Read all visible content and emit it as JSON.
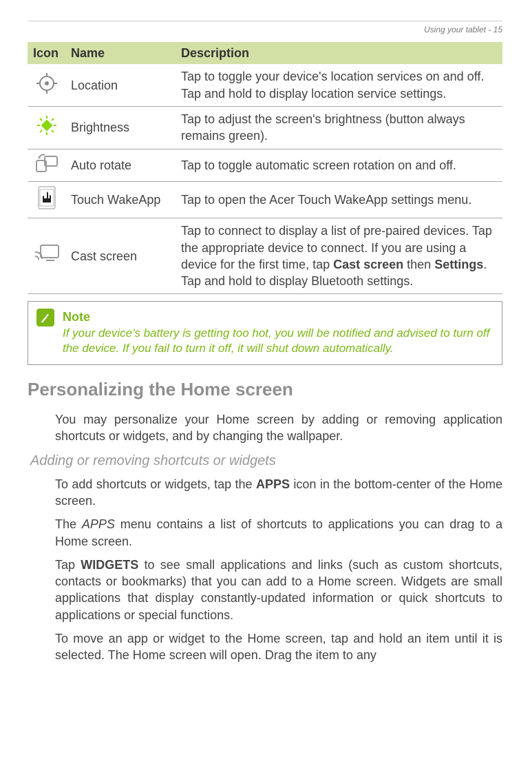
{
  "page_header": "Using your tablet - 15",
  "table": {
    "headers": {
      "icon": "Icon",
      "name": "Name",
      "desc": "Description"
    },
    "rows": [
      {
        "icon": "location-icon",
        "name": "Location",
        "desc": "Tap to toggle your device's location services on and off. Tap and hold to display location service settings."
      },
      {
        "icon": "brightness-icon",
        "name": "Brightness",
        "desc": "Tap to adjust the screen's brightness (button always remains green)."
      },
      {
        "icon": "auto-rotate-icon",
        "name": "Auto rotate",
        "desc": "Tap to toggle automatic screen rotation on and off."
      },
      {
        "icon": "touch-wakeapp-icon",
        "name": "Touch WakeApp",
        "desc": "Tap to open the Acer Touch WakeApp settings menu."
      },
      {
        "icon": "cast-screen-icon",
        "name": "Cast screen",
        "desc_pre": "Tap to connect to display a list of pre-paired devices. Tap the appropriate device to connect. If you are using a device for the first time, tap ",
        "desc_bold1": "Cast screen",
        "desc_mid": " then ",
        "desc_bold2": "Settings",
        "desc_post": ". Tap and hold to display Bluetooth settings."
      }
    ]
  },
  "note": {
    "label": "Note",
    "text": "If your device's battery is getting too hot, you will be notified and advised to turn off the device. If you fail to turn it off, it will shut down automatically."
  },
  "section_heading": "Personalizing the Home screen",
  "para1": "You may personalize your Home screen by adding or removing application shortcuts or widgets, and by changing the wallpaper.",
  "sub_heading": "Adding or removing shortcuts or widgets",
  "para2_pre": "To add shortcuts or widgets, tap the ",
  "para2_bold": "APPS",
  "para2_post": " icon in the bottom-center of the Home screen.",
  "para3_pre": "The ",
  "para3_italic": "APPS",
  "para3_post": " menu contains a list of shortcuts to applications you can drag to a Home screen.",
  "para4_pre": "Tap ",
  "para4_bold": "WIDGETS",
  "para4_post": " to see small applications and links (such as custom shortcuts, contacts or bookmarks) that you can add to a Home screen. Widgets are small applications that display constantly-updated information or quick shortcuts to applications or special functions.",
  "para5": "To move an app or widget to the Home screen, tap and hold an item until it is selected. The Home screen will open. Drag the item to any"
}
